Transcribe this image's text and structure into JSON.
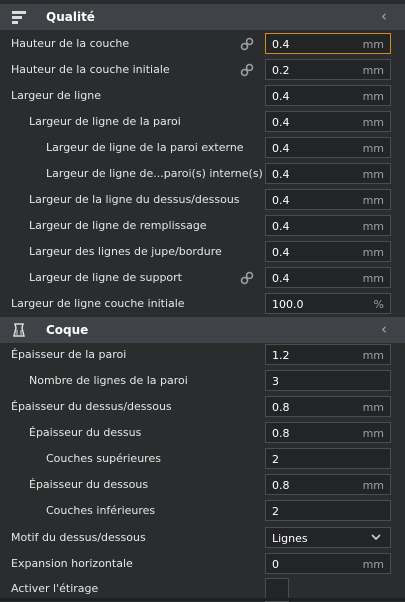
{
  "sections": {
    "quality": {
      "title": "Qualité",
      "icon": "layers-icon",
      "collapse": "‹"
    },
    "shell": {
      "title": "Coque",
      "icon": "shell-icon",
      "collapse": "‹"
    }
  },
  "quality_rows": [
    {
      "label": "Hauteur de la couche",
      "value": "0.4",
      "unit": "mm",
      "linked": true
    },
    {
      "label": "Hauteur de la couche initiale",
      "value": "0.2",
      "unit": "mm",
      "linked": true
    },
    {
      "label": "Largeur de ligne",
      "value": "0.4",
      "unit": "mm"
    },
    {
      "label": "Largeur de ligne de la paroi",
      "value": "0.4",
      "unit": "mm"
    },
    {
      "label": "Largeur de ligne de la paroi externe",
      "value": "0.4",
      "unit": "mm"
    },
    {
      "label": "Largeur de ligne de...paroi(s) interne(s)",
      "value": "0.4",
      "unit": "mm"
    },
    {
      "label": "Largeur de la ligne du dessus/dessous",
      "value": "0.4",
      "unit": "mm"
    },
    {
      "label": "Largeur de ligne de remplissage",
      "value": "0.4",
      "unit": "mm"
    },
    {
      "label": "Largeur des lignes de jupe/bordure",
      "value": "0.4",
      "unit": "mm"
    },
    {
      "label": "Largeur de ligne de support",
      "value": "0.4",
      "unit": "mm",
      "linked": true
    },
    {
      "label": "Largeur de ligne couche initiale",
      "value": "100.0",
      "unit": "%"
    }
  ],
  "shell_rows": [
    {
      "label": "Épaisseur de la paroi",
      "value": "1.2",
      "unit": "mm"
    },
    {
      "label": "Nombre de lignes de la paroi",
      "value": "3",
      "unit": ""
    },
    {
      "label": "Épaisseur du dessus/dessous",
      "value": "0.8",
      "unit": "mm"
    },
    {
      "label": "Épaisseur du dessus",
      "value": "0.8",
      "unit": "mm"
    },
    {
      "label": "Couches supérieures",
      "value": "2",
      "unit": ""
    },
    {
      "label": "Épaisseur du dessous",
      "value": "0.8",
      "unit": "mm"
    },
    {
      "label": "Couches inférieures",
      "value": "2",
      "unit": ""
    },
    {
      "label": "Motif du dessus/dessous",
      "value": "Lignes",
      "unit": "",
      "dropdown": true
    },
    {
      "label": "Expansion horizontale",
      "value": "0",
      "unit": "mm"
    },
    {
      "label": "Activer l'étirage",
      "value": "",
      "unit": "",
      "checkbox": true,
      "checked": false
    }
  ],
  "colors": {
    "accent": "#d48a1c",
    "panel": "#2b2c2e",
    "header": "#3f4246"
  }
}
